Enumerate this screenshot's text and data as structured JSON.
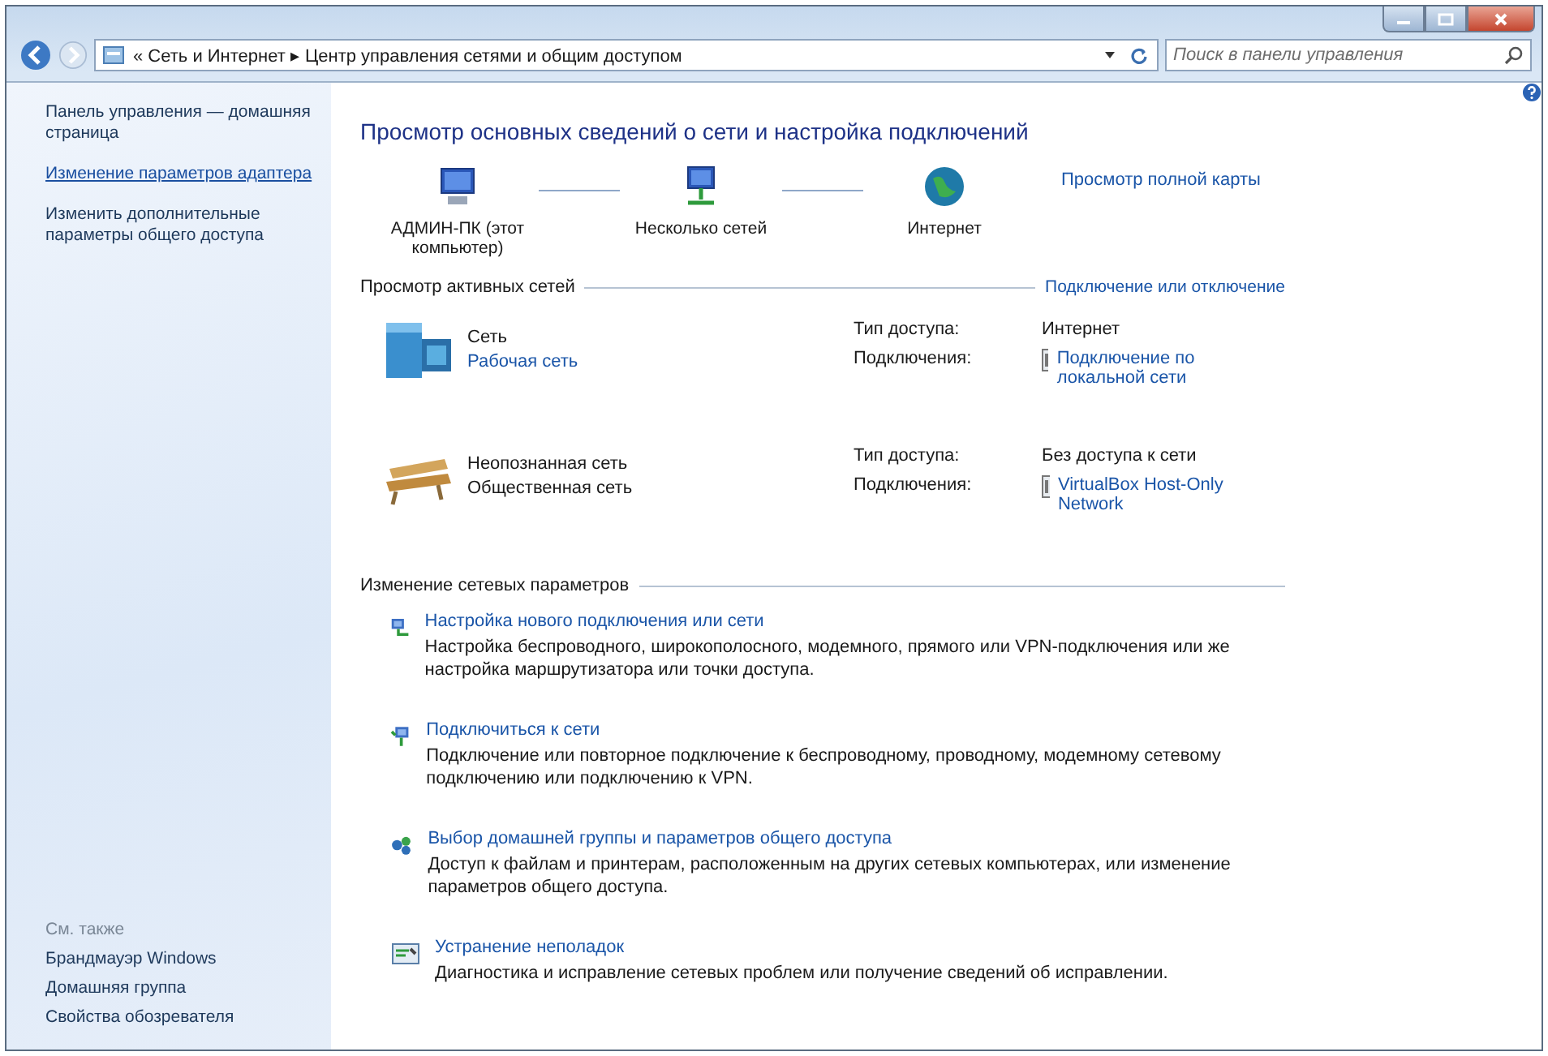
{
  "address_bar": {
    "path": "« Сеть и Интернет ▸ Центр управления сетями и общим доступом"
  },
  "search": {
    "placeholder": "Поиск в панели управления"
  },
  "sidebar": {
    "items": [
      {
        "label": "Панель управления — домашняя страница",
        "hovered": false
      },
      {
        "label": "Изменение параметров адаптера",
        "hovered": true
      },
      {
        "label": "Изменить дополнительные параметры общего доступа",
        "hovered": false
      }
    ],
    "see_also": {
      "heading": "См. также",
      "items": [
        "Брандмауэр Windows",
        "Домашняя группа",
        "Свойства обозревателя"
      ]
    }
  },
  "main": {
    "title": "Просмотр основных сведений о сети и настройка подключений",
    "map": {
      "nodes": [
        {
          "kind": "computer",
          "label": "АДМИН-ПК (этот компьютер)"
        },
        {
          "kind": "networks",
          "label": "Несколько сетей"
        },
        {
          "kind": "internet",
          "label": "Интернет"
        }
      ],
      "full_map_link": "Просмотр полной карты"
    },
    "active_networks": {
      "heading": "Просмотр активных сетей",
      "action_link": "Подключение или отключение",
      "networks": [
        {
          "kind": "work",
          "name": "Сеть",
          "type_link": "Рабочая сеть",
          "access_label": "Тип доступа:",
          "access": "Интернет",
          "connections_label": "Подключения:",
          "connection": "Подключение по локальной сети"
        },
        {
          "kind": "public",
          "name": "Неопознанная сеть",
          "type_text": "Общественная сеть",
          "access_label": "Тип доступа:",
          "access": "Без доступа к сети",
          "connections_label": "Подключения:",
          "connection": "VirtualBox Host-Only Network"
        }
      ]
    },
    "settings": {
      "heading": "Изменение сетевых параметров",
      "tasks": [
        {
          "kind": "new",
          "title": "Настройка нового подключения или сети",
          "description": "Настройка беспроводного, широкополосного, модемного, прямого или VPN-подключения или же настройка маршрутизатора или точки доступа."
        },
        {
          "kind": "connect",
          "title": "Подключиться к сети",
          "description": "Подключение или повторное подключение к беспроводному, проводному, модемному сетевому подключению или подключению к VPN."
        },
        {
          "kind": "share",
          "title": "Выбор домашней группы и параметров общего доступа",
          "description": "Доступ к файлам и принтерам, расположенным на других сетевых компьютерах, или изменение параметров общего доступа."
        },
        {
          "kind": "troubleshoot",
          "title": "Устранение неполадок",
          "description": "Диагностика и исправление сетевых проблем или получение сведений об исправлении."
        }
      ]
    }
  }
}
